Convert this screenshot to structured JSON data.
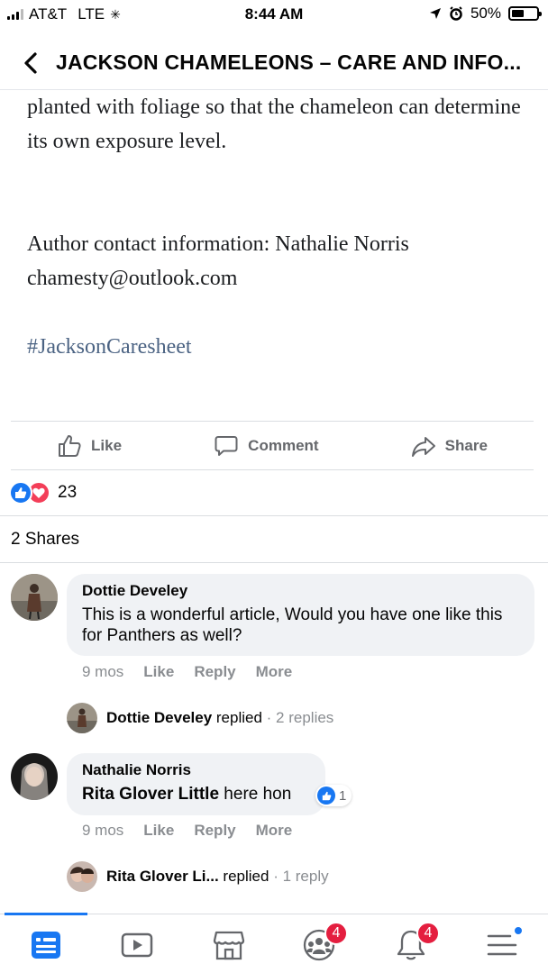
{
  "status_bar": {
    "carrier": "AT&T",
    "network": "LTE",
    "time": "8:44 AM",
    "battery": "50%",
    "battery_level": 0.5
  },
  "header": {
    "title": "JACKSON CHAMELEONS – CARE AND INFO..."
  },
  "article": {
    "para1": "planted with foliage so that the chameleon can determine its own exposure level.",
    "author_line": "Author contact information: Nathalie Norris",
    "email": "chamesty@outlook.com",
    "hashtag": "#JacksonCaresheet"
  },
  "actions": {
    "like": "Like",
    "comment": "Comment",
    "share": "Share"
  },
  "reactions": {
    "count": "23"
  },
  "shares": {
    "label": "2 Shares"
  },
  "comments": [
    {
      "author": "Dottie Develey",
      "text": "This is a wonderful article, Would you have one like this for Panthers as well?",
      "time": "9 mos",
      "like": "Like",
      "reply": "Reply",
      "more": "More",
      "reply_summary": {
        "name": "Dottie Develey",
        "action": " replied",
        "separator": " · ",
        "count": "2 replies"
      }
    },
    {
      "author": "Nathalie Norris",
      "mention": "Rita Glover Little",
      "text": " here hon",
      "reaction_count": "1",
      "time": "9 mos",
      "like": "Like",
      "reply": "Reply",
      "more": "More",
      "reply_summary": {
        "name": "Rita Glover Li...",
        "action": " replied",
        "separator": " · ",
        "count": "1 reply"
      }
    }
  ],
  "tabbar": {
    "groups_badge": "4",
    "notifications_badge": "4"
  },
  "colors": {
    "accent": "#1877f2",
    "badge": "#e41e3f",
    "love": "#f33e58",
    "muted_text": "#8a8d91",
    "bubble": "#f0f2f5"
  }
}
